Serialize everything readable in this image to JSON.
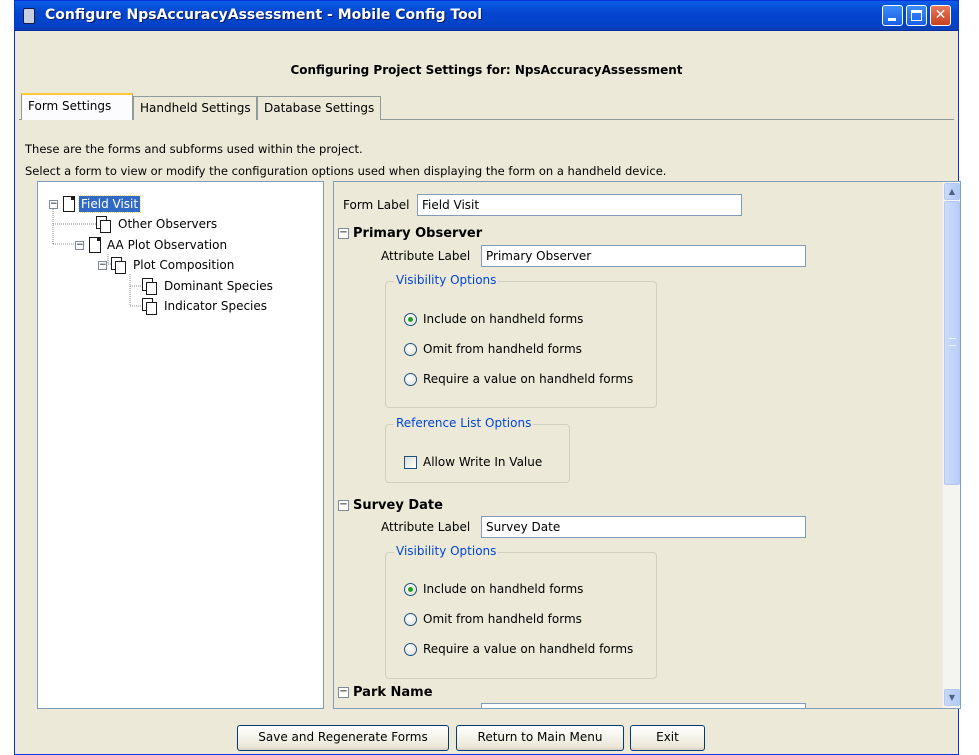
{
  "window": {
    "title": "Configure NpsAccuracyAssessment - Mobile Config Tool",
    "heading": "Configuring Project Settings for: NpsAccuracyAssessment"
  },
  "tabs": [
    {
      "label": "Form Settings",
      "active": true
    },
    {
      "label": "Handheld Settings",
      "active": false
    },
    {
      "label": "Database Settings",
      "active": false
    }
  ],
  "description": {
    "line1": "These are the forms and subforms used within the project.",
    "line2": "Select a form to view or modify the configuration options used when displaying the form on a handheld device."
  },
  "tree": [
    {
      "label": "Field Visit",
      "expander": "−",
      "selected": true
    },
    {
      "label": "Other Observers"
    },
    {
      "label": "AA Plot Observation",
      "expander": "−"
    },
    {
      "label": "Plot Composition",
      "expander": "−"
    },
    {
      "label": "Dominant Species"
    },
    {
      "label": "Indicator Species"
    }
  ],
  "form": {
    "form_label": "Form Label",
    "form_label_value": "Field Visit",
    "attribute_label": "Attribute Label",
    "visibility_title": "Visibility Options",
    "reference_title": "Reference List Options",
    "sections": [
      {
        "title": "Primary Observer",
        "attribute_value": "Primary Observer",
        "options": [
          "Include on handheld forms",
          "Omit from handheld forms",
          "Require a value on handheld forms"
        ],
        "selected_option": "Include on handheld forms",
        "write_in_label": "Allow Write In Value",
        "write_in_checked": false
      },
      {
        "title": "Survey Date",
        "attribute_value": "Survey Date",
        "options": [
          "Include on handheld forms",
          "Omit from handheld forms",
          "Require a value on handheld forms"
        ],
        "selected_option": "Include on handheld forms"
      },
      {
        "title": "Park Name"
      }
    ]
  },
  "buttons": {
    "save": "Save and Regenerate Forms",
    "return": "Return to Main Menu",
    "exit": "Exit"
  },
  "icons": {
    "tree_root": "document-icon",
    "tree_child": "documents-icon"
  },
  "colors": {
    "titlebar": "#0545d0",
    "selection": "#316ac5",
    "group_title": "#0046d5",
    "window_bg": "#ece9d8"
  }
}
